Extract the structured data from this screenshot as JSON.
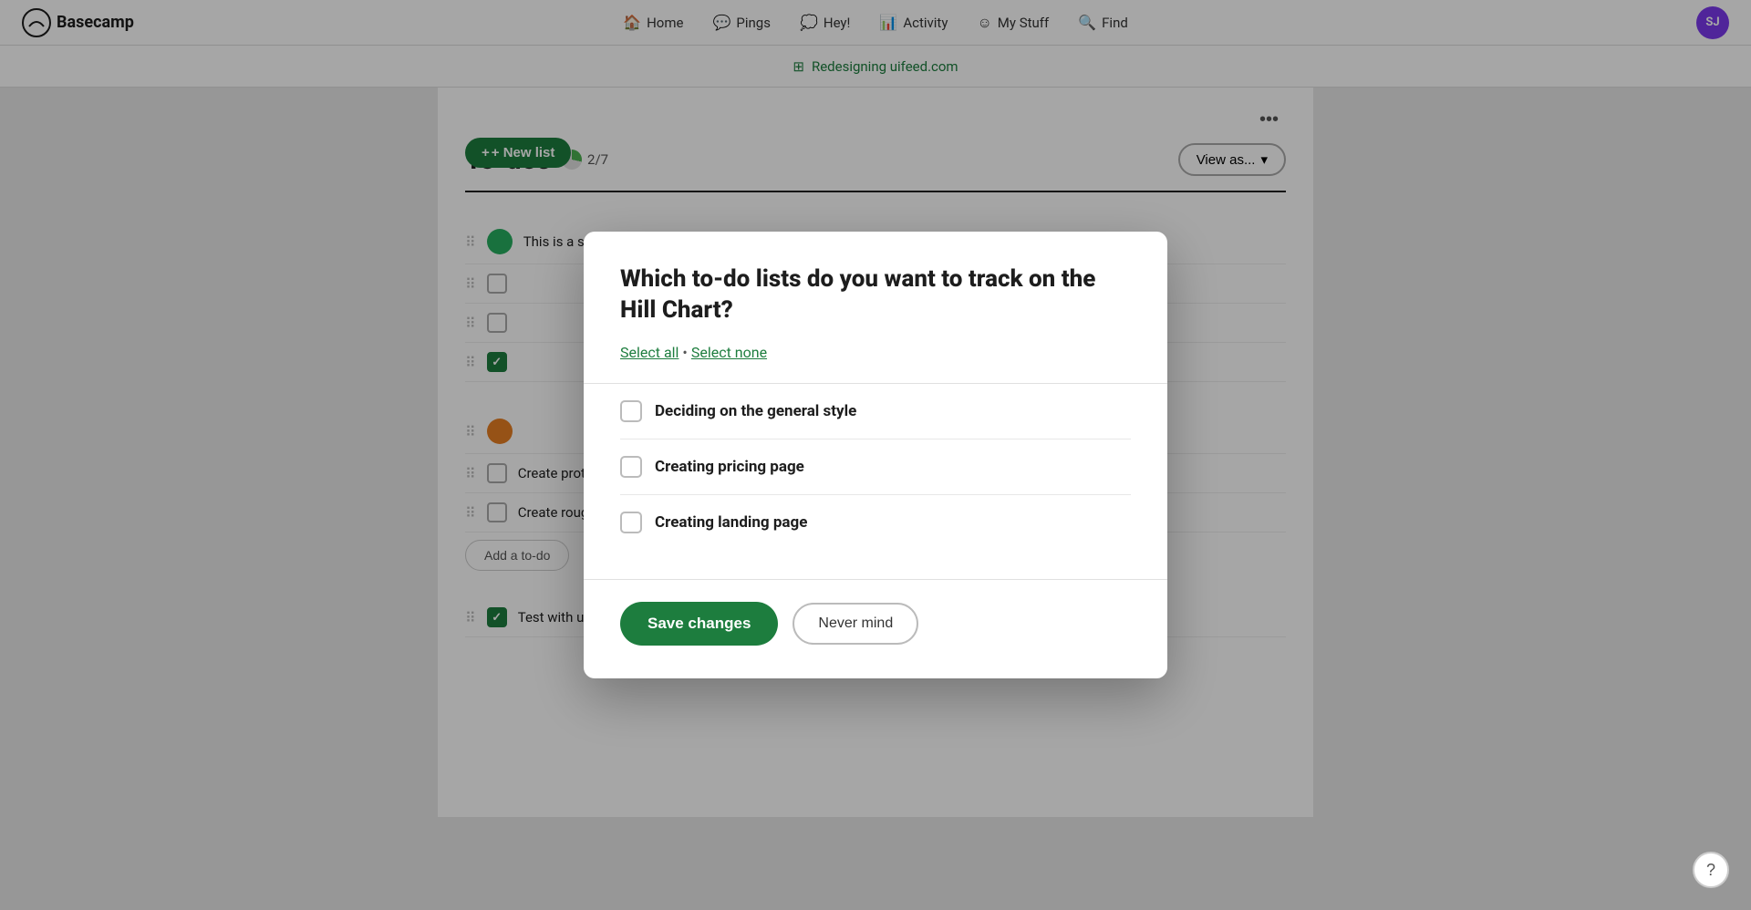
{
  "brand": {
    "name": "Basecamp"
  },
  "nav": {
    "items": [
      {
        "id": "home",
        "label": "Home",
        "icon": "🏠"
      },
      {
        "id": "pings",
        "label": "Pings",
        "icon": "💬"
      },
      {
        "id": "hey",
        "label": "Hey!",
        "icon": "💭"
      },
      {
        "id": "activity",
        "label": "Activity",
        "icon": "📊"
      },
      {
        "id": "mystuff",
        "label": "My Stuff",
        "icon": "☺"
      },
      {
        "id": "find",
        "label": "Find",
        "icon": "🔍"
      }
    ]
  },
  "avatar": {
    "initials": "SJ"
  },
  "project_bar": {
    "icon": "⊞",
    "link_text": "Redesigning uifeed.com"
  },
  "page": {
    "title": "To-dos",
    "progress_fraction": "2/7",
    "new_list_label": "+ New list",
    "view_as_label": "View as...",
    "dots_label": "•••"
  },
  "todo_lists": [
    {
      "items": [
        {
          "id": 1,
          "text": "This is a sample task item",
          "checked": false,
          "avatar_color": "green"
        },
        {
          "id": 2,
          "text": "",
          "checked": false,
          "avatar_color": "green"
        },
        {
          "id": 3,
          "text": "",
          "checked": false,
          "avatar_color": "green"
        },
        {
          "id": 4,
          "text": "",
          "checked": true,
          "avatar_color": "green"
        }
      ]
    },
    {
      "items": [
        {
          "id": 5,
          "text": "",
          "checked": false,
          "avatar_color": "green",
          "has_badge": true
        },
        {
          "id": 6,
          "text": "Create prototype in Figma",
          "checked": false,
          "avatar_color": ""
        },
        {
          "id": 7,
          "text": "Create rough shape in Balsamiq",
          "checked": false,
          "avatar_color": ""
        }
      ],
      "add_label": "Add a to-do"
    },
    {
      "items": [
        {
          "id": 8,
          "text": "Test with users on Usertest",
          "checked": true,
          "avatar_color": ""
        }
      ]
    }
  ],
  "modal": {
    "title": "Which to-do lists do you want to track on the Hill Chart?",
    "select_all_label": "Select all",
    "select_none_label": "Select none",
    "dot_separator": "•",
    "items": [
      {
        "id": 1,
        "label": "Deciding on the general style",
        "checked": false
      },
      {
        "id": 2,
        "label": "Creating pricing page",
        "checked": false
      },
      {
        "id": 3,
        "label": "Creating landing page",
        "checked": false
      }
    ],
    "save_label": "Save changes",
    "never_mind_label": "Never mind"
  },
  "help_btn_label": "?"
}
